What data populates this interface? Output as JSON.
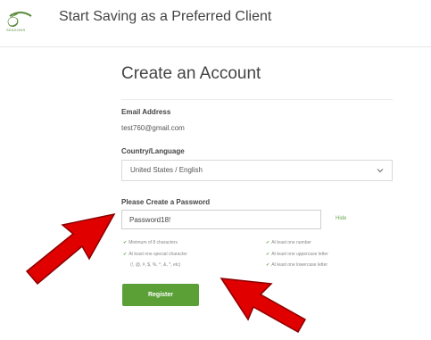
{
  "header": {
    "title": "Start Saving as a Preferred Client",
    "logo_subtext": "SEASONS"
  },
  "form": {
    "title": "Create an Account",
    "email_label": "Email Address",
    "email_value": "test760@gmail.com",
    "country_label": "Country/Language",
    "country_value": "United States / English",
    "password_label": "Please Create a Password",
    "password_value": "Password18!",
    "hide_label": "Hide",
    "requirements": [
      "Minimum of 8 characters",
      "At least one number",
      "At least one special character",
      "At least one uppercase letter",
      "(!, @, #, $, %, ^, &, *, etc)",
      "At least one lowercase letter"
    ],
    "register_label": "Register"
  },
  "colors": {
    "accent_green": "#5aa037",
    "arrow_red": "#e00000"
  },
  "icons": {
    "logo": "seasons-logo-icon",
    "select_chevron": "chevron-down-icon",
    "check": "check-icon",
    "arrow": "red-arrow-icon"
  }
}
